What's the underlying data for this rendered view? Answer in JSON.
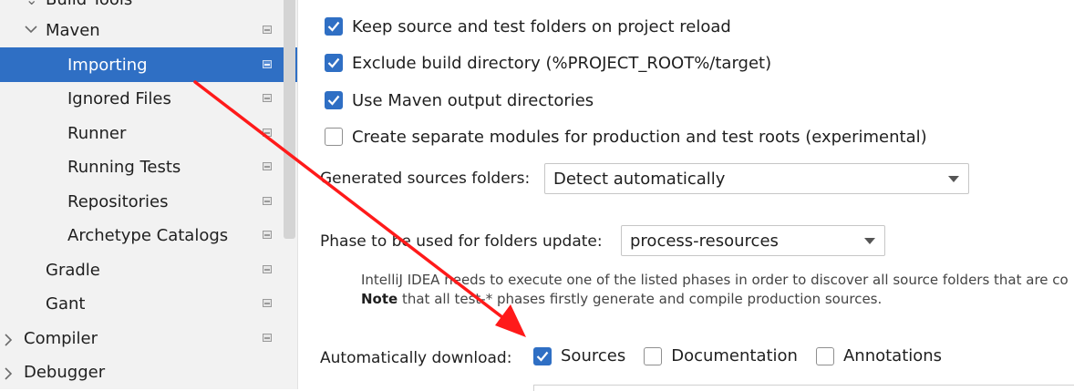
{
  "sidebar": {
    "items": [
      {
        "label": "Build Tools"
      },
      {
        "label": "Maven"
      },
      {
        "label": "Importing"
      },
      {
        "label": "Ignored Files"
      },
      {
        "label": "Runner"
      },
      {
        "label": "Running Tests"
      },
      {
        "label": "Repositories"
      },
      {
        "label": "Archetype Catalogs"
      },
      {
        "label": "Gradle"
      },
      {
        "label": "Gant"
      },
      {
        "label": "Compiler"
      },
      {
        "label": "Debugger"
      }
    ]
  },
  "main": {
    "checkboxes": [
      {
        "label": "Keep source and test folders on project reload",
        "checked": true
      },
      {
        "label": "Exclude build directory (%PROJECT_ROOT%/target)",
        "checked": true
      },
      {
        "label": "Use Maven output directories",
        "checked": true
      },
      {
        "label": "Create separate modules for production and test roots (experimental)",
        "checked": false
      }
    ],
    "generated_sources": {
      "label": "Generated sources folders:",
      "value": "Detect automatically"
    },
    "phase": {
      "label": "Phase to be used for folders update:",
      "value": "process-resources"
    },
    "hint_line1": "IntelliJ IDEA needs to execute one of the listed phases in order to discover all source folders that are co",
    "hint_note_bold": "Note",
    "hint_line2": " that all test-* phases firstly generate and compile production sources.",
    "auto_download": {
      "label": "Automatically download:",
      "options": [
        {
          "label": "Sources",
          "checked": true
        },
        {
          "label": "Documentation",
          "checked": false
        },
        {
          "label": "Annotations",
          "checked": false
        }
      ]
    }
  },
  "colors": {
    "selection": "#2f6fc4",
    "annotation_arrow": "#ff1a1a"
  }
}
